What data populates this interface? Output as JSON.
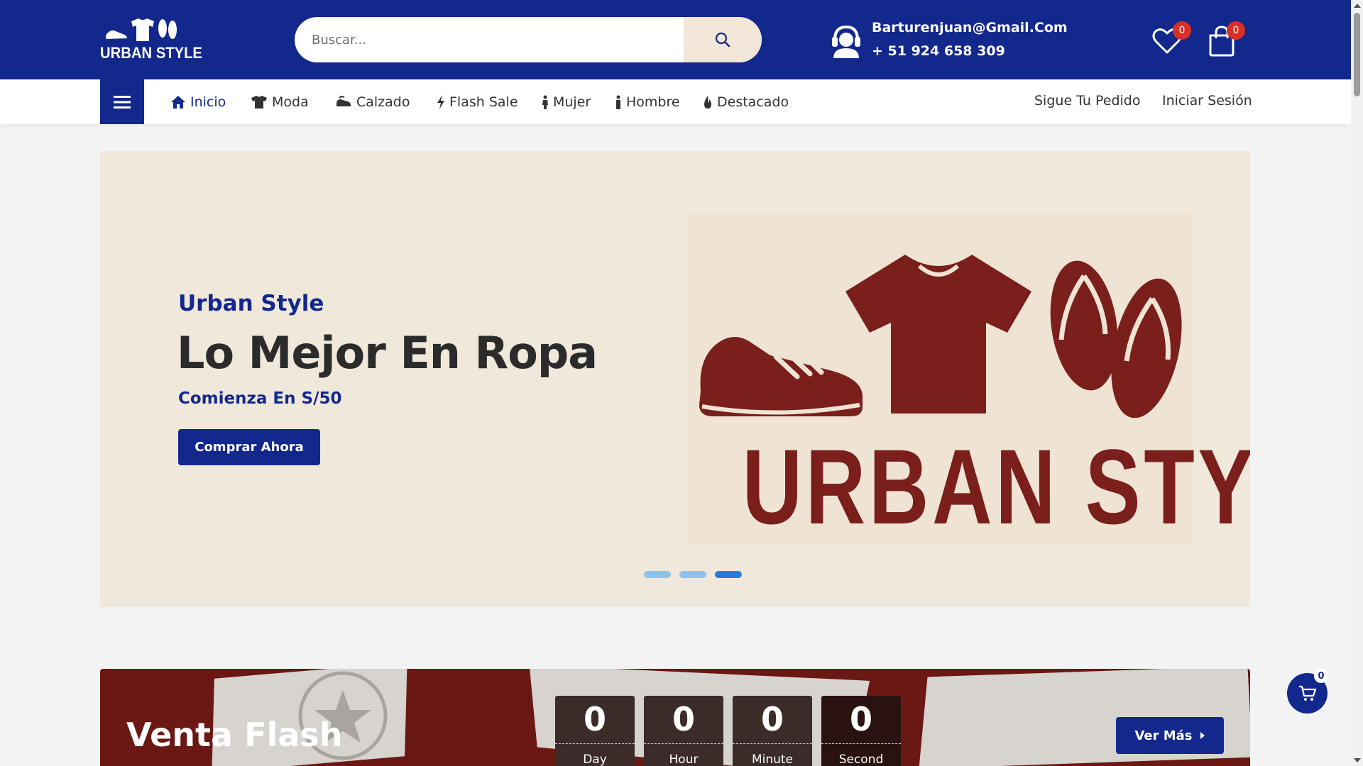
{
  "header": {
    "logo_text": "URBAN STYLE",
    "search_placeholder": "Buscar...",
    "email": "Barturenjuan@Gmail.Com",
    "phone": "+ 51 924 658 309",
    "wishlist_count": "0",
    "cart_count": "0"
  },
  "nav": {
    "items": [
      {
        "label": "Inicio",
        "icon": "home-icon"
      },
      {
        "label": "Moda",
        "icon": "tshirt-icon"
      },
      {
        "label": "Calzado",
        "icon": "shoe-icon"
      },
      {
        "label": "Flash Sale",
        "icon": "bolt-icon"
      },
      {
        "label": "Mujer",
        "icon": "female-icon"
      },
      {
        "label": "Hombre",
        "icon": "male-icon"
      },
      {
        "label": "Destacado",
        "icon": "fire-icon"
      }
    ],
    "track_order": "Sigue Tu Pedido",
    "login": "Iniciar Sesión"
  },
  "hero": {
    "subtitle": "Urban Style",
    "title": "Lo Mejor En Ropa",
    "price_line": "Comienza En S/50",
    "cta": "Comprar Ahora",
    "brand_art_text": "URBAN STYLE",
    "active_slide": 3,
    "slide_count": 3
  },
  "flash": {
    "title": "Venta Flash",
    "countdown": [
      {
        "value": "0",
        "label": "Day"
      },
      {
        "value": "0",
        "label": "Hour"
      },
      {
        "value": "0",
        "label": "Minute"
      },
      {
        "value": "0",
        "label": "Second"
      }
    ],
    "more_button": "Ver Más"
  },
  "floating_cart": {
    "count": "0"
  },
  "colors": {
    "brand_blue": "#13288c",
    "hero_bg": "#f1e8dc",
    "art_maroon": "#7a1f1b",
    "flash_bg": "#6b1713",
    "badge_red": "#d93025"
  }
}
